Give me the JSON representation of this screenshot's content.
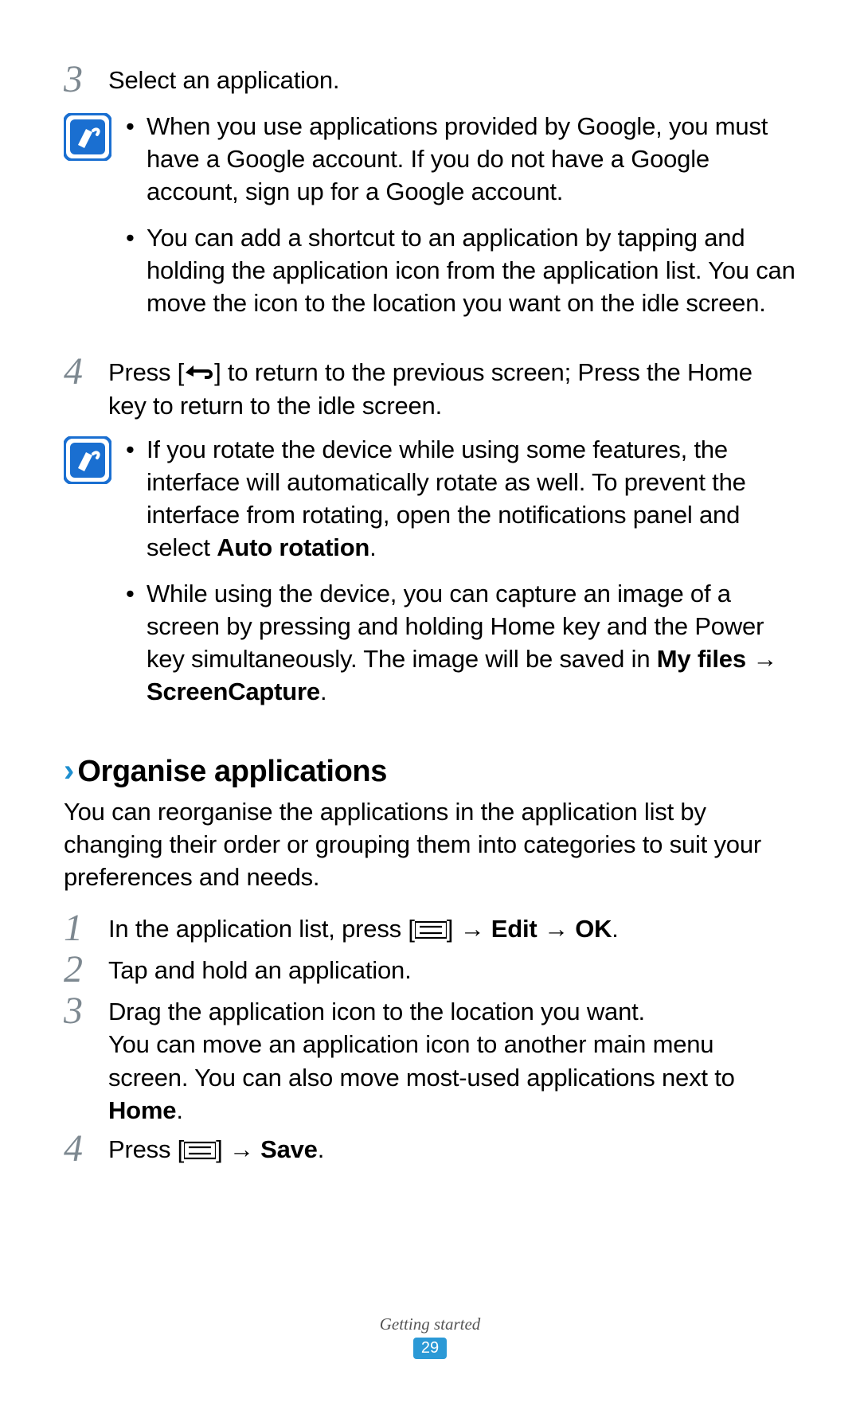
{
  "steps": {
    "s3": {
      "num": "3",
      "text": "Select an application."
    },
    "s4": {
      "num": "4",
      "text_pre": "Press [",
      "text_post": "] to return to the previous screen; Press the Home key to return to the idle screen."
    }
  },
  "note1": {
    "b1": "When you use applications provided by Google, you must have a Google account. If you do not have a Google account, sign up for a Google account.",
    "b2": "You can add a shortcut to an application by tapping and holding the application icon from the application list. You can move the icon to the location you want on the idle screen."
  },
  "note2": {
    "b1_pre": "If you rotate the device while using some features, the interface will automatically rotate as well. To prevent the interface from rotating, open the notifications panel and select ",
    "b1_bold": "Auto rotation",
    "b1_post": ".",
    "b2_pre": "While using the device, you can capture an image of a screen by pressing and holding Home key and the Power key simultaneously. The image will be saved in ",
    "b2_bold": "My files → ScreenCapture",
    "b2_post": "."
  },
  "section": {
    "chevron": "›",
    "title": "Organise applications",
    "intro": "You can reorganise the applications in the application list by changing their order or grouping them into categories to suit your preferences and needs."
  },
  "org_steps": {
    "s1": {
      "num": "1",
      "pre": "In the application list, press [",
      "post": "] → ",
      "bold1": "Edit",
      "mid": " → ",
      "bold2": "OK",
      "end": "."
    },
    "s2": {
      "num": "2",
      "text": "Tap and hold an application."
    },
    "s3": {
      "num": "3",
      "text": "Drag the application icon to the location you want.",
      "extra_pre": "You can move an application icon to another main menu screen. You can also move most-used applications next to ",
      "extra_bold": "Home",
      "extra_post": "."
    },
    "s4": {
      "num": "4",
      "pre": "Press [",
      "post": "] → ",
      "bold": "Save",
      "end": "."
    }
  },
  "footer": {
    "section": "Getting started",
    "page": "29"
  }
}
